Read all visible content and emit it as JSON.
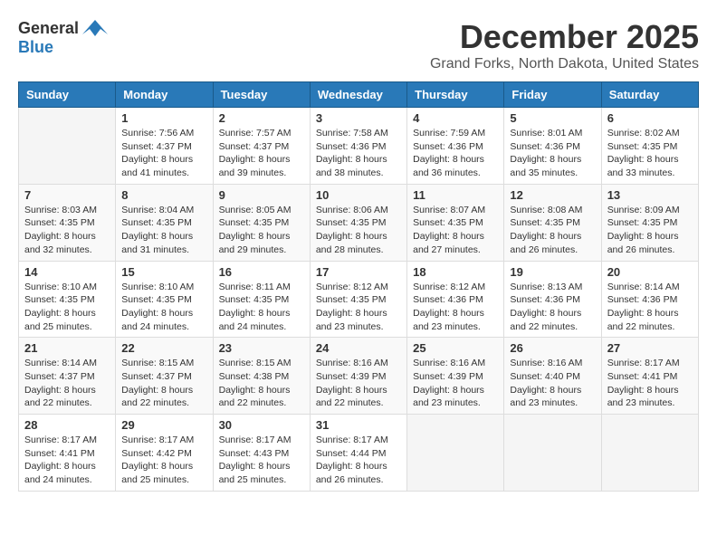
{
  "header": {
    "logo_general": "General",
    "logo_blue": "Blue",
    "month": "December 2025",
    "location": "Grand Forks, North Dakota, United States"
  },
  "days_of_week": [
    "Sunday",
    "Monday",
    "Tuesday",
    "Wednesday",
    "Thursday",
    "Friday",
    "Saturday"
  ],
  "weeks": [
    [
      {
        "day": "",
        "info": ""
      },
      {
        "day": "1",
        "info": "Sunrise: 7:56 AM\nSunset: 4:37 PM\nDaylight: 8 hours\nand 41 minutes."
      },
      {
        "day": "2",
        "info": "Sunrise: 7:57 AM\nSunset: 4:37 PM\nDaylight: 8 hours\nand 39 minutes."
      },
      {
        "day": "3",
        "info": "Sunrise: 7:58 AM\nSunset: 4:36 PM\nDaylight: 8 hours\nand 38 minutes."
      },
      {
        "day": "4",
        "info": "Sunrise: 7:59 AM\nSunset: 4:36 PM\nDaylight: 8 hours\nand 36 minutes."
      },
      {
        "day": "5",
        "info": "Sunrise: 8:01 AM\nSunset: 4:36 PM\nDaylight: 8 hours\nand 35 minutes."
      },
      {
        "day": "6",
        "info": "Sunrise: 8:02 AM\nSunset: 4:35 PM\nDaylight: 8 hours\nand 33 minutes."
      }
    ],
    [
      {
        "day": "7",
        "info": "Sunrise: 8:03 AM\nSunset: 4:35 PM\nDaylight: 8 hours\nand 32 minutes."
      },
      {
        "day": "8",
        "info": "Sunrise: 8:04 AM\nSunset: 4:35 PM\nDaylight: 8 hours\nand 31 minutes."
      },
      {
        "day": "9",
        "info": "Sunrise: 8:05 AM\nSunset: 4:35 PM\nDaylight: 8 hours\nand 29 minutes."
      },
      {
        "day": "10",
        "info": "Sunrise: 8:06 AM\nSunset: 4:35 PM\nDaylight: 8 hours\nand 28 minutes."
      },
      {
        "day": "11",
        "info": "Sunrise: 8:07 AM\nSunset: 4:35 PM\nDaylight: 8 hours\nand 27 minutes."
      },
      {
        "day": "12",
        "info": "Sunrise: 8:08 AM\nSunset: 4:35 PM\nDaylight: 8 hours\nand 26 minutes."
      },
      {
        "day": "13",
        "info": "Sunrise: 8:09 AM\nSunset: 4:35 PM\nDaylight: 8 hours\nand 26 minutes."
      }
    ],
    [
      {
        "day": "14",
        "info": "Sunrise: 8:10 AM\nSunset: 4:35 PM\nDaylight: 8 hours\nand 25 minutes."
      },
      {
        "day": "15",
        "info": "Sunrise: 8:10 AM\nSunset: 4:35 PM\nDaylight: 8 hours\nand 24 minutes."
      },
      {
        "day": "16",
        "info": "Sunrise: 8:11 AM\nSunset: 4:35 PM\nDaylight: 8 hours\nand 24 minutes."
      },
      {
        "day": "17",
        "info": "Sunrise: 8:12 AM\nSunset: 4:35 PM\nDaylight: 8 hours\nand 23 minutes."
      },
      {
        "day": "18",
        "info": "Sunrise: 8:12 AM\nSunset: 4:36 PM\nDaylight: 8 hours\nand 23 minutes."
      },
      {
        "day": "19",
        "info": "Sunrise: 8:13 AM\nSunset: 4:36 PM\nDaylight: 8 hours\nand 22 minutes."
      },
      {
        "day": "20",
        "info": "Sunrise: 8:14 AM\nSunset: 4:36 PM\nDaylight: 8 hours\nand 22 minutes."
      }
    ],
    [
      {
        "day": "21",
        "info": "Sunrise: 8:14 AM\nSunset: 4:37 PM\nDaylight: 8 hours\nand 22 minutes."
      },
      {
        "day": "22",
        "info": "Sunrise: 8:15 AM\nSunset: 4:37 PM\nDaylight: 8 hours\nand 22 minutes."
      },
      {
        "day": "23",
        "info": "Sunrise: 8:15 AM\nSunset: 4:38 PM\nDaylight: 8 hours\nand 22 minutes."
      },
      {
        "day": "24",
        "info": "Sunrise: 8:16 AM\nSunset: 4:39 PM\nDaylight: 8 hours\nand 22 minutes."
      },
      {
        "day": "25",
        "info": "Sunrise: 8:16 AM\nSunset: 4:39 PM\nDaylight: 8 hours\nand 23 minutes."
      },
      {
        "day": "26",
        "info": "Sunrise: 8:16 AM\nSunset: 4:40 PM\nDaylight: 8 hours\nand 23 minutes."
      },
      {
        "day": "27",
        "info": "Sunrise: 8:17 AM\nSunset: 4:41 PM\nDaylight: 8 hours\nand 23 minutes."
      }
    ],
    [
      {
        "day": "28",
        "info": "Sunrise: 8:17 AM\nSunset: 4:41 PM\nDaylight: 8 hours\nand 24 minutes."
      },
      {
        "day": "29",
        "info": "Sunrise: 8:17 AM\nSunset: 4:42 PM\nDaylight: 8 hours\nand 25 minutes."
      },
      {
        "day": "30",
        "info": "Sunrise: 8:17 AM\nSunset: 4:43 PM\nDaylight: 8 hours\nand 25 minutes."
      },
      {
        "day": "31",
        "info": "Sunrise: 8:17 AM\nSunset: 4:44 PM\nDaylight: 8 hours\nand 26 minutes."
      },
      {
        "day": "",
        "info": ""
      },
      {
        "day": "",
        "info": ""
      },
      {
        "day": "",
        "info": ""
      }
    ]
  ]
}
